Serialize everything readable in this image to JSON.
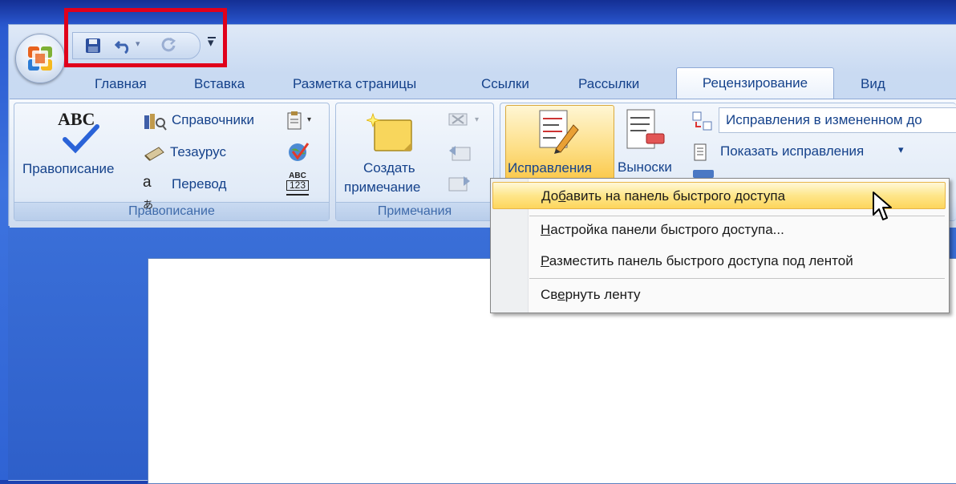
{
  "tabs": [
    "Главная",
    "Вставка",
    "Разметка страницы",
    "Ссылки",
    "Рассылки",
    "Рецензирование",
    "Вид"
  ],
  "active_tab": "Рецензирование",
  "qat": {
    "icons": [
      "save-icon",
      "undo-icon",
      "redo-icon",
      "customize-dropdown-icon"
    ]
  },
  "groups": {
    "proofing": {
      "label": "Правописание",
      "big_button_icon_text": "ABC",
      "big_button_label": "Правописание",
      "items": [
        "Справочники",
        "Тезаурус",
        "Перевод"
      ],
      "wordcount_icon_top": "ABC",
      "wordcount_icon_bottom": "123"
    },
    "comments": {
      "label": "Примечания",
      "new_comment_line1": "Создать",
      "new_comment_line2": "примечание"
    },
    "tracking": {
      "track_changes_label": "Исправления",
      "balloons_label": "Выноски",
      "display_for_review_value": "Исправления в измененном до",
      "show_markup_label": "Показать исправления"
    }
  },
  "menu": {
    "items": [
      {
        "pre": "До",
        "u": "б",
        "post": "авить на панель быстрого доступа"
      },
      {
        "pre": "",
        "u": "Н",
        "post": "астройка панели быстрого доступа..."
      },
      {
        "pre": "",
        "u": "Р",
        "post": "азместить панель быстрого доступа под лентой"
      },
      {
        "pre": "Св",
        "u": "е",
        "post": "рнуть ленту"
      }
    ]
  },
  "colors": {
    "highlight_box": "#e0001b",
    "tab_text": "#15428b",
    "menu_hover": "#fee68a"
  }
}
